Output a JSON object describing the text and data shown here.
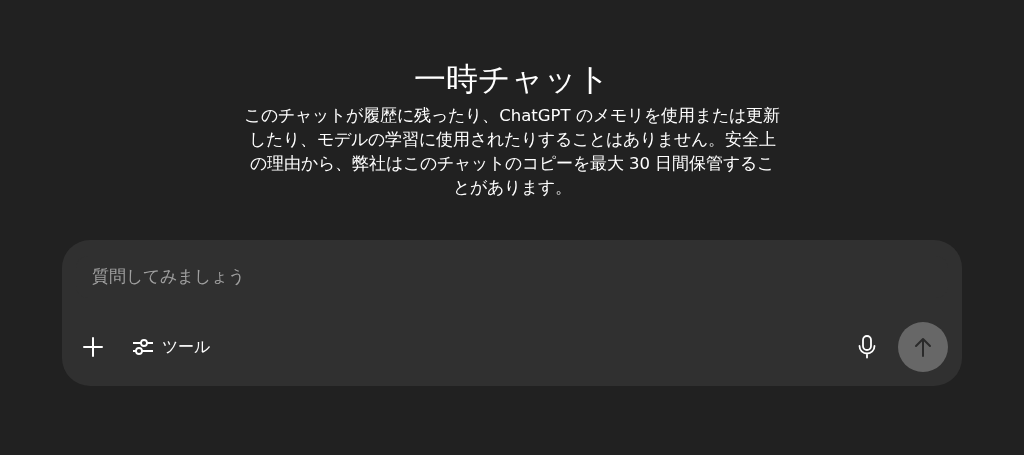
{
  "title": "一時チャット",
  "description": "このチャットが履歴に残ったり、ChatGPT のメモリを使用または更新したり、モデルの学習に使用されたりすることはありません。安全上の理由から、弊社はこのチャットのコピーを最大 30 日間保管することがあります。",
  "composer": {
    "placeholder": "質問してみましょう",
    "tools_label": "ツール",
    "send_disabled": true
  }
}
